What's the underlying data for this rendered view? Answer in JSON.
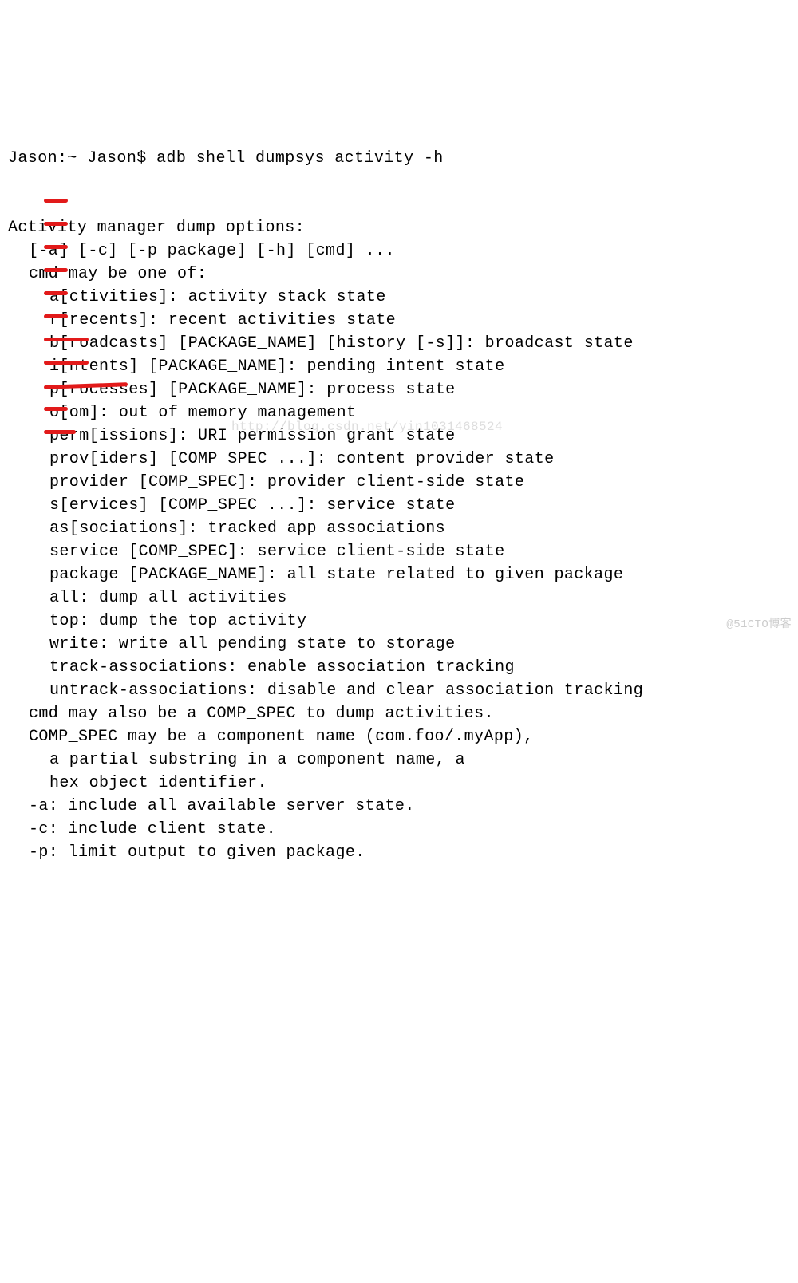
{
  "terminal": {
    "prompt": "Jason:~ Jason$ ",
    "command": "adb shell dumpsys activity -h",
    "lines": [
      {
        "indent": "",
        "text": "Activity manager dump options:"
      },
      {
        "indent": "i2",
        "text": "[-a] [-c] [-p package] [-h] [cmd] ..."
      },
      {
        "indent": "i2",
        "text": "cmd may be one of:"
      },
      {
        "indent": "i4",
        "text": "a[ctivities]: activity stack state"
      },
      {
        "indent": "i4",
        "text": "r[recents]: recent activities state"
      },
      {
        "indent": "i4",
        "text": "b[roadcasts] [PACKAGE_NAME] [history [-s]]: broadcast state"
      },
      {
        "indent": "i4",
        "text": "i[ntents] [PACKAGE_NAME]: pending intent state"
      },
      {
        "indent": "i4",
        "text": "p[rocesses] [PACKAGE_NAME]: process state"
      },
      {
        "indent": "i4",
        "text": "o[om]: out of memory management"
      },
      {
        "indent": "i4",
        "text": "perm[issions]: URI permission grant state"
      },
      {
        "indent": "i4",
        "text": "prov[iders] [COMP_SPEC ...]: content provider state"
      },
      {
        "indent": "i4",
        "text": "provider [COMP_SPEC]: provider client-side state"
      },
      {
        "indent": "i4",
        "text": "s[ervices] [COMP_SPEC ...]: service state"
      },
      {
        "indent": "i4",
        "text": "as[sociations]: tracked app associations"
      },
      {
        "indent": "i4",
        "text": "service [COMP_SPEC]: service client-side state"
      },
      {
        "indent": "i4",
        "text": "package [PACKAGE_NAME]: all state related to given package"
      },
      {
        "indent": "i4",
        "text": "all: dump all activities"
      },
      {
        "indent": "i4",
        "text": "top: dump the top activity"
      },
      {
        "indent": "i4",
        "text": "write: write all pending state to storage"
      },
      {
        "indent": "i4",
        "text": "track-associations: enable association tracking"
      },
      {
        "indent": "i4",
        "text": "untrack-associations: disable and clear association tracking"
      },
      {
        "indent": "i2",
        "text": "cmd may also be a COMP_SPEC to dump activities."
      },
      {
        "indent": "i2",
        "text": "COMP_SPEC may be a component name (com.foo/.myApp),"
      },
      {
        "indent": "i4",
        "text": "a partial substring in a component name, a"
      },
      {
        "indent": "i4",
        "text": "hex object identifier."
      },
      {
        "indent": "i2",
        "text": "-a: include all available server state."
      },
      {
        "indent": "i2",
        "text": "-c: include client state."
      },
      {
        "indent": "i2",
        "text": "-p: limit output to given package."
      }
    ],
    "marks": [
      "m1",
      "m2",
      "m3",
      "m4",
      "m5",
      "m6",
      "m7",
      "m8",
      "m9",
      "m10",
      "m11"
    ]
  },
  "watermark1": "http://blog.csdn.net/yin1031468524",
  "watermark2": "@51CTO博客"
}
